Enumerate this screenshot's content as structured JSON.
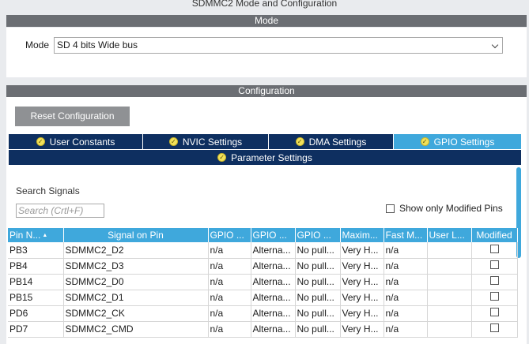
{
  "window_title": "SDMMC2 Mode and Configuration",
  "mode_section": {
    "header": "Mode",
    "mode_label": "Mode",
    "mode_value": "SD 4 bits Wide bus"
  },
  "config_section": {
    "header": "Configuration",
    "reset_button": "Reset Configuration",
    "tabs": [
      {
        "label": "User Constants",
        "active": false
      },
      {
        "label": "NVIC Settings",
        "active": false
      },
      {
        "label": "DMA Settings",
        "active": false
      },
      {
        "label": "GPIO Settings",
        "active": true
      }
    ],
    "param_tab": "Parameter Settings",
    "search_label": "Search Signals",
    "search_placeholder": "Search (Crtl+F)",
    "show_modified_label": "Show only Modified Pins",
    "accent_color": "#3fa8dc",
    "tab_color": "#0e2f60"
  },
  "table": {
    "columns": [
      "Pin N...",
      "Signal on Pin",
      "GPIO ...",
      "GPIO ...",
      "GPIO ...",
      "Maxim...",
      "Fast M...",
      "User L...",
      "Modified"
    ],
    "rows": [
      [
        "PB3",
        "SDMMC2_D2",
        "n/a",
        "Alterna...",
        "No pull...",
        "Very H...",
        "n/a",
        "",
        ""
      ],
      [
        "PB4",
        "SDMMC2_D3",
        "n/a",
        "Alterna...",
        "No pull...",
        "Very H...",
        "n/a",
        "",
        ""
      ],
      [
        "PB14",
        "SDMMC2_D0",
        "n/a",
        "Alterna...",
        "No pull...",
        "Very H...",
        "n/a",
        "",
        ""
      ],
      [
        "PB15",
        "SDMMC2_D1",
        "n/a",
        "Alterna...",
        "No pull...",
        "Very H...",
        "n/a",
        "",
        ""
      ],
      [
        "PD6",
        "SDMMC2_CK",
        "n/a",
        "Alterna...",
        "No pull...",
        "Very H...",
        "n/a",
        "",
        ""
      ],
      [
        "PD7",
        "SDMMC2_CMD",
        "n/a",
        "Alterna...",
        "No pull...",
        "Very H...",
        "n/a",
        "",
        ""
      ]
    ]
  }
}
